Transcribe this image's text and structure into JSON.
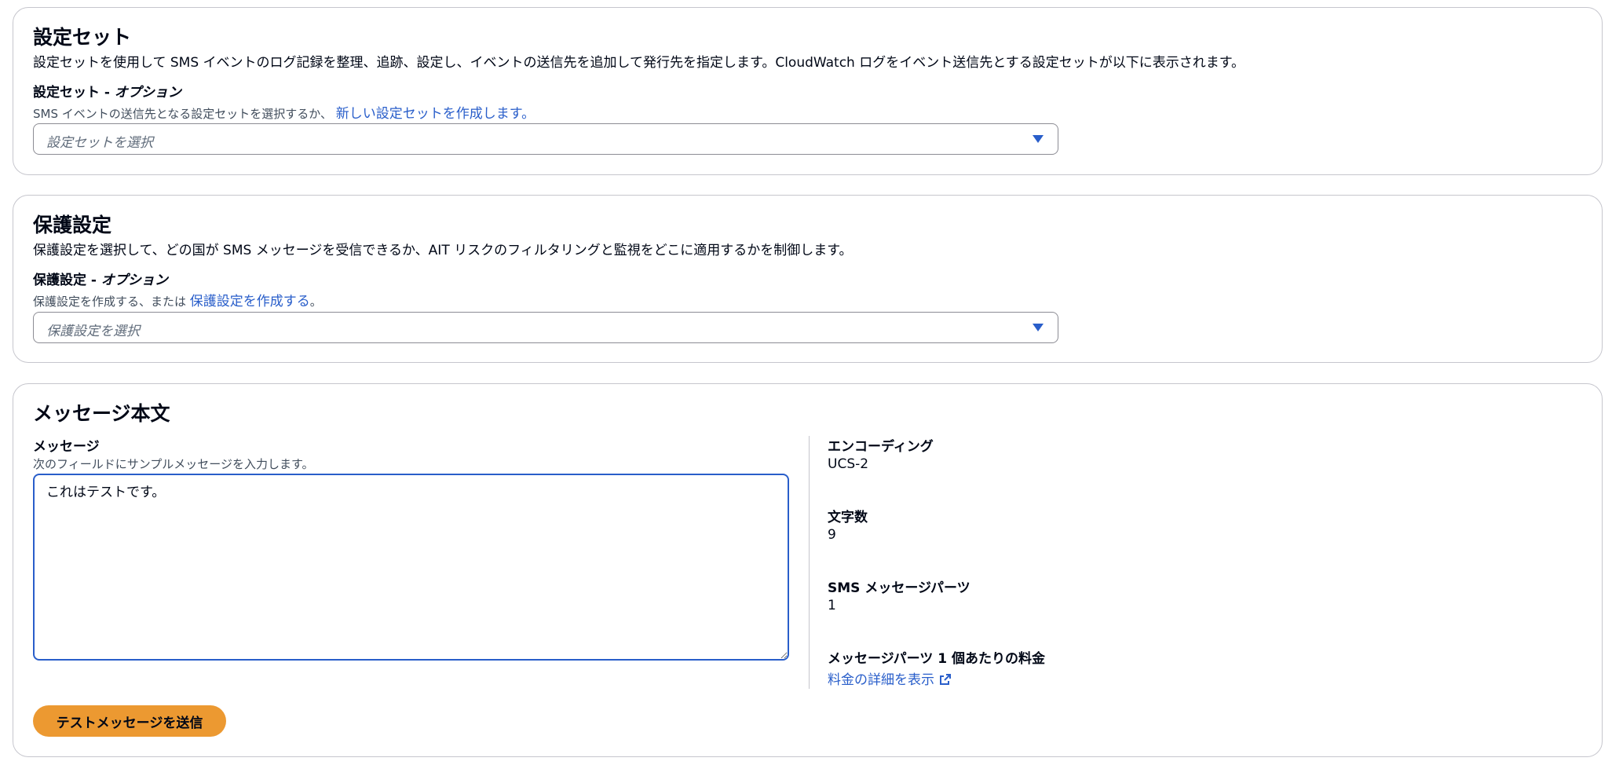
{
  "config_set": {
    "title": "設定セット",
    "description": "設定セットを使用して SMS イベントのログ記録を整理、追跡、設定し、イベントの送信先を追加して発行先を指定します。CloudWatch ログをイベント送信先とする設定セットが以下に表示されます。",
    "field_label": "設定セット - ",
    "field_optional": "オプション",
    "hint_text": "SMS イベントの送信先となる設定セットを選択するか、",
    "hint_link": "新しい設定セットを作成します。",
    "select_placeholder": "設定セットを選択"
  },
  "protection": {
    "title": "保護設定",
    "description": "保護設定を選択して、どの国が SMS メッセージを受信できるか、AIT リスクのフィルタリングと監視をどこに適用するかを制御します。",
    "field_label": "保護設定 - ",
    "field_optional": "オプション",
    "hint_text": "保護設定を作成する、または ",
    "hint_link": "保護設定を作成する",
    "hint_suffix": "。",
    "select_placeholder": "保護設定を選択"
  },
  "message_body": {
    "title": "メッセージ本文",
    "message_label": "メッセージ",
    "message_hint": "次のフィールドにサンプルメッセージを入力します。",
    "message_value": "これはテストです。",
    "encoding_label": "エンコーディング",
    "encoding_value": "UCS-2",
    "char_count_label": "文字数",
    "char_count_value": "9",
    "parts_label": "SMS メッセージパーツ",
    "parts_value": "1",
    "price_label": "メッセージパーツ 1 個あたりの料金",
    "price_link": "料金の詳細を表示",
    "send_button": "テストメッセージを送信"
  },
  "colors": {
    "accent": "#295eca",
    "button": "#ec9931",
    "border": "#c6c6cd"
  },
  "icons": {
    "caret": "caret-down-icon",
    "external": "external-link-icon"
  }
}
